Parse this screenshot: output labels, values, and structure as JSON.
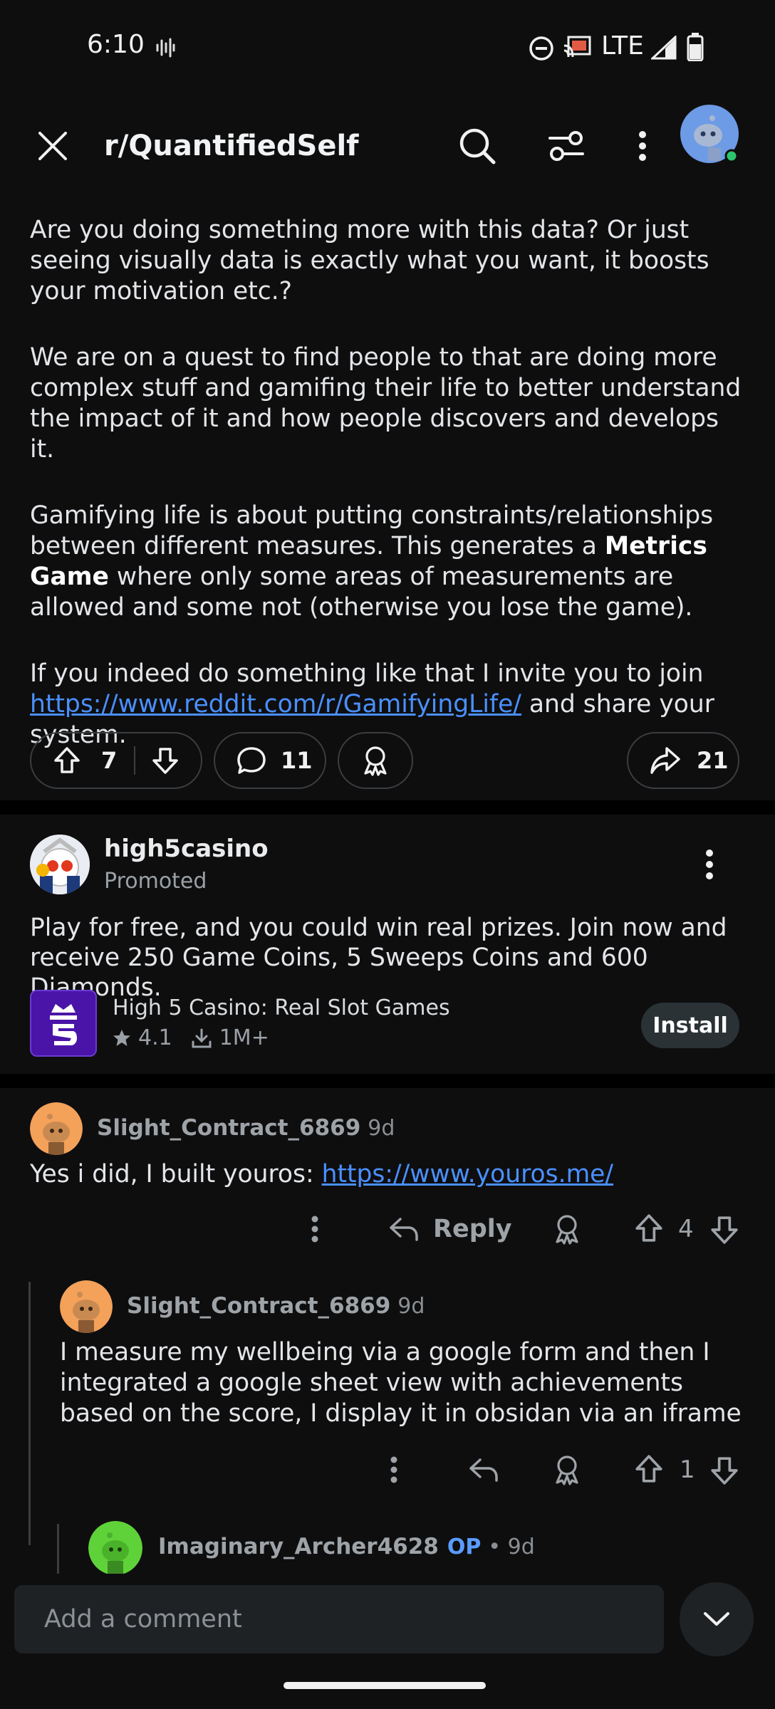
{
  "status_bar": {
    "time": "6:10",
    "network": "LTE"
  },
  "header": {
    "subreddit": "r/QuantifiedSelf"
  },
  "post": {
    "paragraphs": [
      "Are you doing something more with this data? Or just seeing visually data is exactly what you want, it boosts your motivation etc.?",
      "We are on a quest to find people to that are doing more complex stuff and gamifing their life to better understand the impact of it and how people discovers and develops it."
    ],
    "p3_before": "Gamifying life is about putting constraints/relationships between different measures. This generates a ",
    "p3_bold": "Metrics Game",
    "p3_after": " where only some areas of measurements are allowed and some not (otherwise you lose the game).",
    "p4_before": "If you indeed do something like that I invite you to join ",
    "p4_link": "https://www.reddit.com/r/GamifyingLife/",
    "p4_after": " and share your system.",
    "upvotes": "7",
    "comments": "11",
    "shares": "21"
  },
  "ad": {
    "advertiser": "high5casino",
    "label": "Promoted",
    "text": "Play for free, and you could win real prizes. Join now and receive 250 Game Coins, 5 Sweeps Coins and 600 Diamonds.",
    "app_name": "High 5 Casino: Real Slot Games",
    "rating": "4.1",
    "downloads": "1M+",
    "install_label": "Install"
  },
  "comments": [
    {
      "author": "Slight_Contract_6869",
      "age": "9d",
      "text_before": "Yes i did, I built youros: ",
      "link": "https://www.youros.me/",
      "reply_label": "Reply",
      "votes": "4"
    },
    {
      "author": "Slight_Contract_6869",
      "age": "9d",
      "text": "I measure my wellbeing via a google form and then I integrated a google sheet view with achievements based on the score, I display it in obsidan via an iframe",
      "votes": "1"
    },
    {
      "author": "Imaginary_Archer4628",
      "op_label": "OP",
      "age": "• 9d"
    }
  ],
  "composer": {
    "placeholder": "Add a comment"
  },
  "colors": {
    "link": "#4a90ff",
    "background": "#0e0e0f",
    "op": "#5a9cff"
  }
}
